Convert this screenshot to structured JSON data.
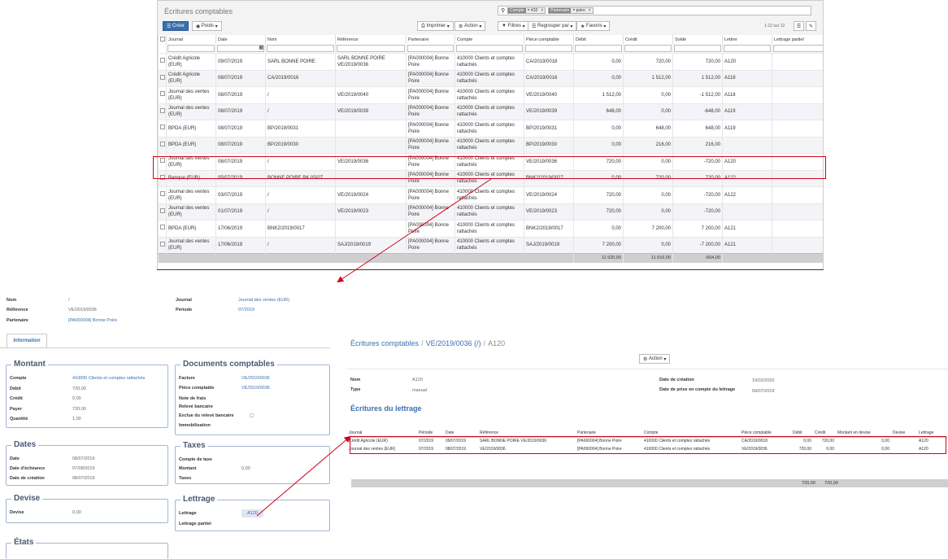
{
  "list": {
    "title": "Écritures comptables",
    "search_facets": [
      {
        "label": "Compte",
        "value": "= 410"
      },
      {
        "label": "Partenaire",
        "value": "= poire"
      }
    ],
    "btn_create": "Créer",
    "btn_weights": "Poids",
    "btn_print": "Imprimer",
    "btn_action": "Action",
    "btn_filters": "Filtres",
    "btn_group": "Regrouper par",
    "btn_fav": "Favoris",
    "pager": "1-12 sur 12",
    "columns": [
      "Journal",
      "Date",
      "Nom",
      "Référence",
      "Partenaire",
      "Compte",
      "Pièce comptable",
      "Débit",
      "Crédit",
      "Solde",
      "Lettrer",
      "Lettrage partiel"
    ],
    "rows": [
      [
        "Crédit Agricole (EUR)",
        "09/07/2019",
        "SARL BONNE POIRE",
        "SARL BONNE POIRE VE/2019/0036",
        "[PA000004] Bonne Poire",
        "410000 Clients et comptes rattachés",
        "CA/2019/0018",
        "0,00",
        "720,00",
        "720,00",
        "A120",
        ""
      ],
      [
        "Crédit Agricole (EUR)",
        "08/07/2019",
        "CA/2019/0016",
        "",
        "[PA000004] Bonne Poire",
        "410000 Clients et comptes rattachés",
        "CA/2019/0016",
        "0,00",
        "1 512,00",
        "1 512,00",
        "A118",
        ""
      ],
      [
        "Journal des ventes (EUR)",
        "08/07/2019",
        "/",
        "VE/2019/0040",
        "[PA000004] Bonne Poire",
        "410000 Clients et comptes rattachés",
        "VE/2019/0040",
        "1 512,00",
        "0,00",
        "-1 512,00",
        "A118",
        ""
      ],
      [
        "Journal des ventes (EUR)",
        "08/07/2019",
        "/",
        "VE/2019/0039",
        "[PA000004] Bonne Poire",
        "410000 Clients et comptes rattachés",
        "VE/2019/0039",
        "648,00",
        "0,00",
        "-648,00",
        "A119",
        ""
      ],
      [
        "BPDA (EUR)",
        "08/07/2019",
        "BP/2019/0031",
        "",
        "[PA000004] Bonne Poire",
        "410000 Clients et comptes rattachés",
        "BP/2019/0031",
        "0,00",
        "648,00",
        "648,00",
        "A119",
        ""
      ],
      [
        "BPDA (EUR)",
        "08/07/2019",
        "BP/2019/0030",
        "",
        "[PA000004] Bonne Poire",
        "410000 Clients et comptes rattachés",
        "BP/2019/0030",
        "0,00",
        "216,00",
        "216,00",
        "",
        ""
      ],
      [
        "Journal des ventes (EUR)",
        "08/07/2019",
        "/",
        "VE/2019/0036",
        "[PA000004] Bonne Poire",
        "410000 Clients et comptes rattachés",
        "VE/2019/0036",
        "720,00",
        "0,00",
        "-720,00",
        "A120",
        ""
      ],
      [
        "Banque (EUR)",
        "05/07/2019",
        "BONNE POIRE BK 05/07",
        "",
        "[PA000004] Bonne Poire",
        "410000 Clients et comptes rattachés",
        "BNK2/2019/0027",
        "0,00",
        "720,00",
        "720,00",
        "A122",
        ""
      ],
      [
        "Journal des ventes (EUR)",
        "03/07/2019",
        "/",
        "VE/2019/0024",
        "[PA000004] Bonne Poire",
        "410000 Clients et comptes rattachés",
        "VE/2019/0024",
        "720,00",
        "0,00",
        "-720,00",
        "A122",
        ""
      ],
      [
        "Journal des ventes (EUR)",
        "01/07/2019",
        "/",
        "VE/2019/0023",
        "[PA000004] Bonne Poire",
        "410000 Clients et comptes rattachés",
        "VE/2019/0023",
        "720,00",
        "0,00",
        "-720,00",
        "",
        ""
      ],
      [
        "BPDA (EUR)",
        "17/06/2019",
        "BNK2/2019/0017",
        "",
        "[PA000004] Bonne Poire",
        "410000 Clients et comptes rattachés",
        "BNK2/2019/0017",
        "0,00",
        "7 200,00",
        "7 200,00",
        "A121",
        ""
      ],
      [
        "Journal des ventes (EUR)",
        "17/06/2019",
        "/",
        "SAJ/2019/0019",
        "[PA000004] Bonne Poire",
        "410000 Clients et comptes rattachés",
        "SAJ/2019/0019",
        "7 200,00",
        "0,00",
        "-7 200,00",
        "A121",
        ""
      ]
    ],
    "totals": {
      "debit": "11 520,00",
      "credit": "11 016,00",
      "solde": "-504,00"
    }
  },
  "form": {
    "nom_label": "Nom",
    "nom": "/",
    "ref_label": "Référence",
    "ref": "VE/2019/0036",
    "partner_label": "Partenaire",
    "partner": "[PA000004] Bonne Poire",
    "journal_label": "Journal",
    "journal": "Journal des ventes (EUR)",
    "period_label": "Période",
    "period": "07/2019",
    "tab": "Information",
    "montant": {
      "title": "Montant",
      "rows": [
        [
          "Compte",
          "410000 Clients et comptes rattachés"
        ],
        [
          "Débit",
          "720,00"
        ],
        [
          "Crédit",
          "0,00"
        ],
        [
          "Payer",
          "720,00"
        ],
        [
          "Quantité",
          "1,00"
        ]
      ]
    },
    "docs": {
      "title": "Documents comptables",
      "rows": [
        [
          "Facture",
          "VE/2019/0036"
        ],
        [
          "Pièce comptable",
          "VE/2019/0036"
        ],
        [
          "Note de frais",
          ""
        ],
        [
          "Relevé bancaire",
          ""
        ],
        [
          "Exclue du relevé bancaire",
          ""
        ],
        [
          "Immobilisation",
          ""
        ]
      ]
    },
    "dates": {
      "title": "Dates",
      "rows": [
        [
          "Date",
          "08/07/2019"
        ],
        [
          "Date d'échéance",
          "07/08/2019"
        ],
        [
          "Date de création",
          "08/07/2019"
        ]
      ]
    },
    "taxes": {
      "title": "Taxes",
      "rows": [
        [
          "Compte de taxe",
          ""
        ],
        [
          "Montant",
          "0,00"
        ],
        [
          "Taxes",
          ""
        ]
      ]
    },
    "devise": {
      "title": "Devise",
      "rows": [
        [
          "Devise",
          "0,00"
        ]
      ]
    },
    "lettrage": {
      "title": "Lettrage",
      "lettrage_label": "Lettrage",
      "lettrage_value": "A120",
      "partial_label": "Lettrage partiel"
    },
    "etats": {
      "title": "États"
    }
  },
  "reco": {
    "breadcrumb": [
      "Écritures comptables",
      "VE/2019/0036 (/)",
      "A120"
    ],
    "action": "Action",
    "nom_label": "Nom",
    "nom": "A120",
    "type_label": "Type",
    "type": "manual",
    "created_label": "Date de création",
    "created": "19/02/2020",
    "considered_label": "Date de prise en compte du lettrage",
    "considered": "09/07/2019",
    "section": "Écritures du lettrage",
    "columns": [
      "Journal",
      "Période",
      "Date",
      "Référence",
      "Partenaire",
      "Compte",
      "Pièce comptable",
      "Débit",
      "Crédit",
      "Montant en devise",
      "Devise",
      "Lettrage"
    ],
    "rows": [
      [
        "Crédit Agricole (EUR)",
        "07/2019",
        "09/07/2019",
        "SARL BONNE POIRE VE/2019/0036",
        "[PA000004] Bonne Poire",
        "410000 Clients et comptes rattachés",
        "CA/2019/0018",
        "0,00",
        "720,00",
        "0,00",
        "",
        "A120"
      ],
      [
        "Journal des ventes (EUR)",
        "07/2019",
        "08/07/2019",
        "VE/2019/0036",
        "[PA000004] Bonne Poire",
        "410000 Clients et comptes rattachés",
        "VE/2019/0036",
        "720,00",
        "0,00",
        "0,00",
        "",
        "A120"
      ]
    ],
    "totals": {
      "debit": "720,00",
      "credit": "720,00"
    }
  }
}
